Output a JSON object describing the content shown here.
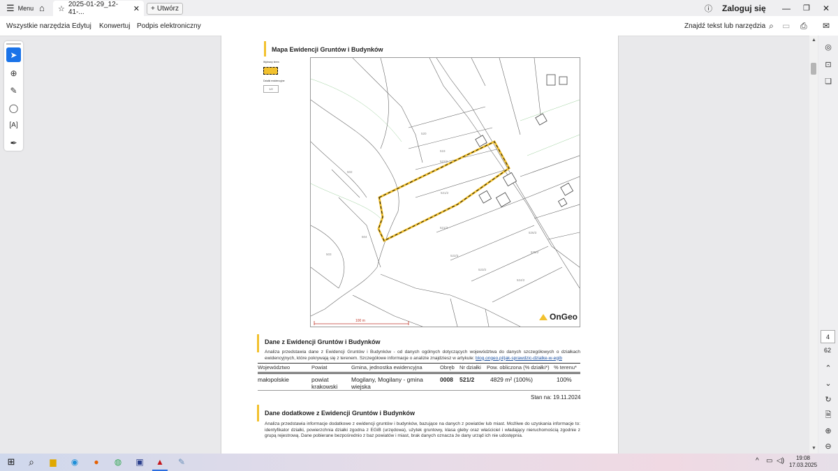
{
  "titlebar": {
    "menu_label": "Menu",
    "tab_title": "2025-01-29_12-41-...",
    "new_tab_label": "Utwórz",
    "login_label": "Zaloguj się"
  },
  "menubar": {
    "items": [
      "Wszystkie narzędzia",
      "Edytuj",
      "Konwertuj",
      "Podpis elektroniczny"
    ],
    "search_label": "Znajdź tekst lub narzędzia"
  },
  "page_nav": {
    "current": "4",
    "total": "62"
  },
  "document": {
    "map_title": "Mapa Ewidencji Gruntów i Budynków",
    "legend_selected": "Wybrany teren",
    "legend_parcels": "Działki ewidencyjne",
    "legend_parcel_example": "1/2",
    "scale_label": "100 m",
    "ongeo_logo": "OnGeo",
    "parcel_labels": [
      "522/2",
      "521/2",
      "521/3",
      "520",
      "519",
      "522/3",
      "523/2",
      "524/2",
      "525/2",
      "526/3",
      "504",
      "503",
      "502"
    ],
    "section1_title": "Dane z Ewidencji Gruntów i Budynków",
    "section1_text": "Analiza przedstawia dane z Ewidencji Gruntów i Budynków - od danych ogólnych dotyczących województwa do danych szczegółowych o działkach ewidencyjnych, które pokrywają się z terenem. Szczegółowe informacje o analizie znajdziesz w artykule:",
    "section1_link": "blog.ongeo.pl/jak-sprawdzic-dzialke-w-egib",
    "table_headers": [
      "Województwo",
      "Powiat",
      "Gmina, jednostka ewidencyjna",
      "Obręb",
      "Nr działki",
      "Pow. obliczona (% działki*)",
      "% terenu*"
    ],
    "table_row": {
      "wojewodztwo": "małopolskie",
      "powiat": "powiat krakowski",
      "gmina": "Mogilany, Mogilany - gmina wiejska",
      "obreb": "0008",
      "nr_dzialki": "521/2",
      "powierzchnia": "4829 m² (100%)",
      "procent": "100%"
    },
    "stan_na": "Stan na: 19.11.2024",
    "section2_title": "Dane dodatkowe z Ewidencji Gruntów i Budynków",
    "section2_text": "Analiza przedstawia informacje dodatkowe z ewidencji gruntów i budynków, bazujące na danych z powiatów lub miast. Możliwe do uzyskania informacje to: identyfikator działki, powierzchnia działki zgodna z EGiB (urzędowa), użytek gruntowy, klasa gleby oraz właściciel i władający nieruchomością zgodnie z grupą rejestrową. Dane pobierane bezpośrednio z baz powiatów i miast, brak danych oznacza że dany urząd ich nie udostępnia."
  },
  "taskbar": {
    "time": "19:08",
    "date": "17.03.2025"
  },
  "colors": {
    "accent_yellow": "#f2c12e",
    "highlight_blue": "#1a73e8"
  }
}
